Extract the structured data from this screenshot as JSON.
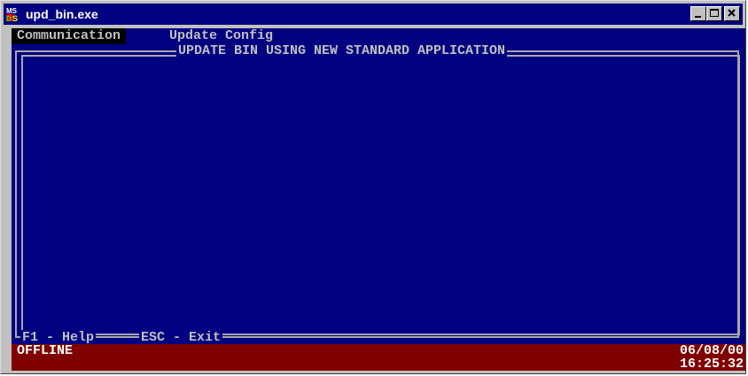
{
  "window": {
    "title": "upd_bin.exe",
    "icon": "ms-dos-icon",
    "controls": [
      "minimize",
      "maximize",
      "close"
    ]
  },
  "menubar": {
    "items": [
      {
        "label": "Communication",
        "selected": true
      },
      {
        "label": "Update Config",
        "selected": false
      }
    ]
  },
  "panel": {
    "title": "UPDATE BIN USING NEW STANDARD APPLICATION"
  },
  "footer": {
    "help": "F1 - Help",
    "exit": "ESC - Exit"
  },
  "status": {
    "state": "OFFLINE",
    "date": "06/08/00",
    "time": "16:25:32"
  },
  "colors": {
    "title_bar": "#000080",
    "console_bg": "#000080",
    "status_bg": "#800000",
    "text": "#c0c0c0"
  }
}
